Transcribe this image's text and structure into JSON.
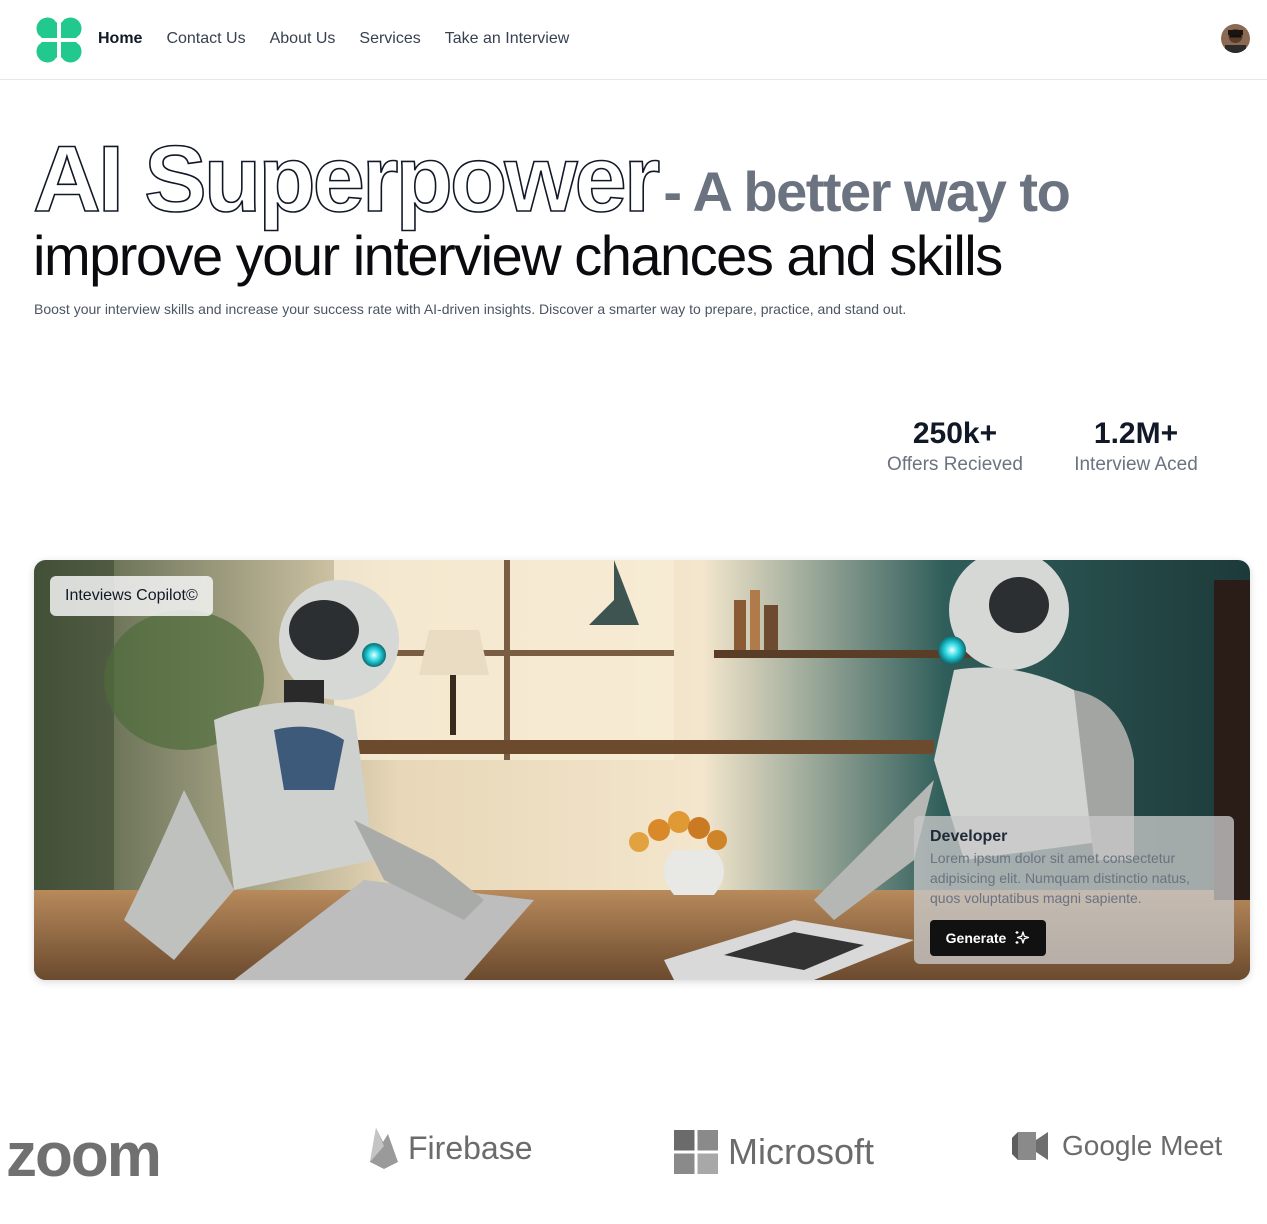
{
  "nav": {
    "items": [
      {
        "label": "Home",
        "active": true
      },
      {
        "label": "Contact Us",
        "active": false
      },
      {
        "label": "About Us",
        "active": false
      },
      {
        "label": "Services",
        "active": false
      },
      {
        "label": "Take an Interview",
        "active": false
      }
    ]
  },
  "hero": {
    "outline_title": "AI Superpower",
    "grey_title": "- A better way to",
    "title_line2": "improve your interview chances and skills",
    "subtitle": "Boost your interview skills and increase your success rate with AI-driven insights. Discover a smarter way to prepare, practice, and stand out."
  },
  "stats": [
    {
      "value": "250k+",
      "label": "Offers Recieved"
    },
    {
      "value": "1.2M+",
      "label": "Interview Aced"
    }
  ],
  "card": {
    "tag": "Inteviews Copilot©",
    "panel_title": "Developer",
    "panel_desc": "Lorem ipsum dolor sit amet consectetur adipisicing elit. Numquam distinctio natus, quos voluptatibus magni sapiente.",
    "button_label": "Generate"
  },
  "brands": [
    "zoom",
    "Firebase",
    "Microsoft",
    "Google Meet"
  ],
  "colors": {
    "brand_green": "#22c98e",
    "outline_text": "#111827",
    "grey_text": "#6b7280"
  }
}
